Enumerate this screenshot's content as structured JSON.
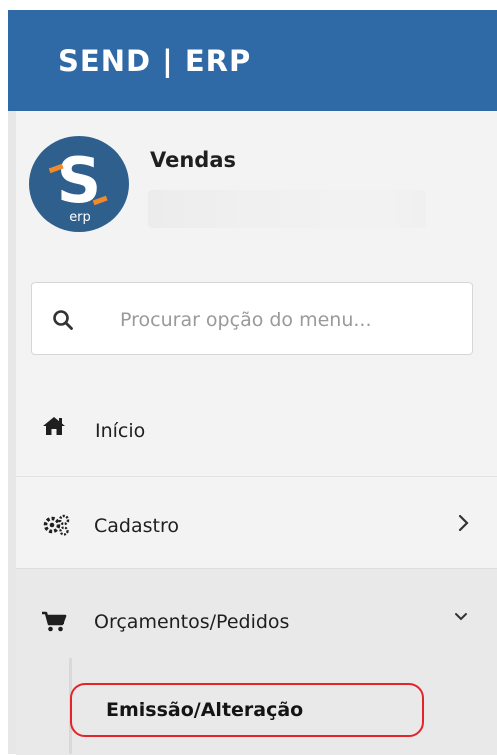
{
  "header": {
    "brand": "SEND | ERP",
    "brand_color": "#2f6aa7"
  },
  "user": {
    "avatar_letter": "S",
    "avatar_sub": "erp",
    "module_name": "Vendas"
  },
  "search": {
    "placeholder": "Procurar opção do menu..."
  },
  "menu": {
    "items": [
      {
        "label": "Início",
        "icon": "home-icon"
      },
      {
        "label": "Cadastro",
        "icon": "gears-icon",
        "chevron": "chevron-right-icon"
      },
      {
        "label": "Orçamentos/Pedidos",
        "icon": "cart-icon",
        "chevron": "chevron-down-icon",
        "expanded": true
      }
    ],
    "subitems": [
      {
        "label": "Emissão/Alteração",
        "highlighted": true,
        "highlight_color": "#e3252a"
      }
    ]
  }
}
